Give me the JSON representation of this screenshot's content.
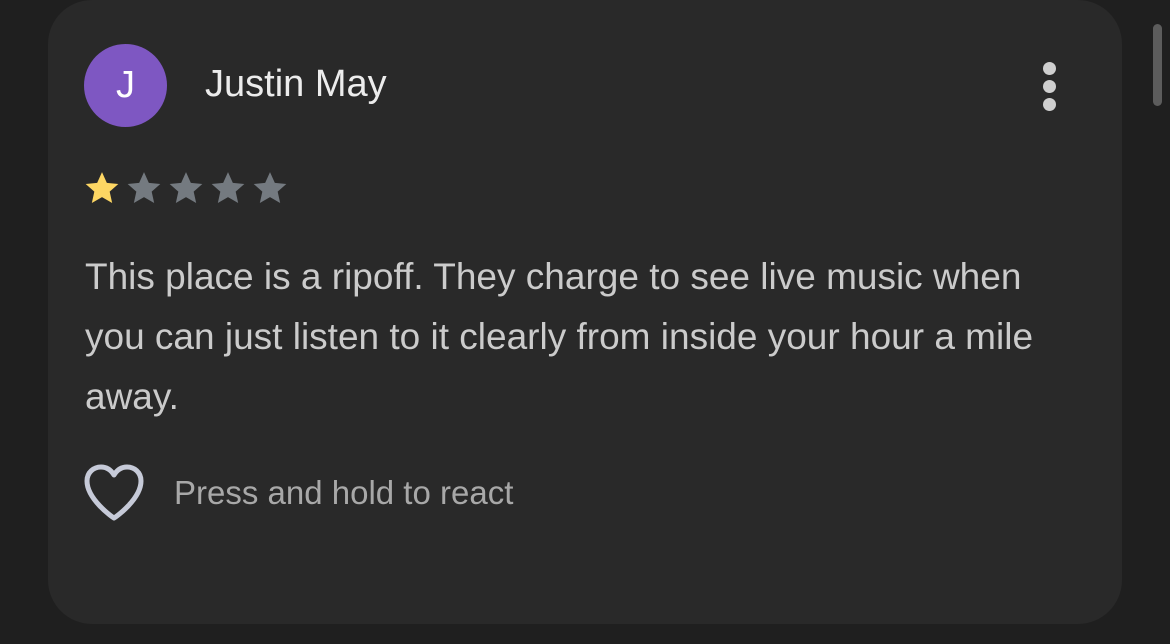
{
  "review": {
    "author": {
      "initial": "J",
      "name": "Justin May",
      "avatar_color": "#7e57c2"
    },
    "menu_icon": "more-vertical-icon",
    "rating": {
      "value": 1,
      "max": 5,
      "filled_color": "#fdd663",
      "empty_color": "#747a80"
    },
    "text": "This place is a ripoff. They charge to see live music when you can just listen to it clearly from inside your hour a mile away.",
    "react": {
      "icon": "heart-outline-icon",
      "label": "Press and hold to react"
    }
  },
  "colors": {
    "background": "#1f1f1f",
    "card": "#292929",
    "name_text": "#ececec",
    "body_text": "#cbcbcb",
    "secondary_text": "#a8a8a8",
    "heart_outline": "#c6cad8"
  }
}
